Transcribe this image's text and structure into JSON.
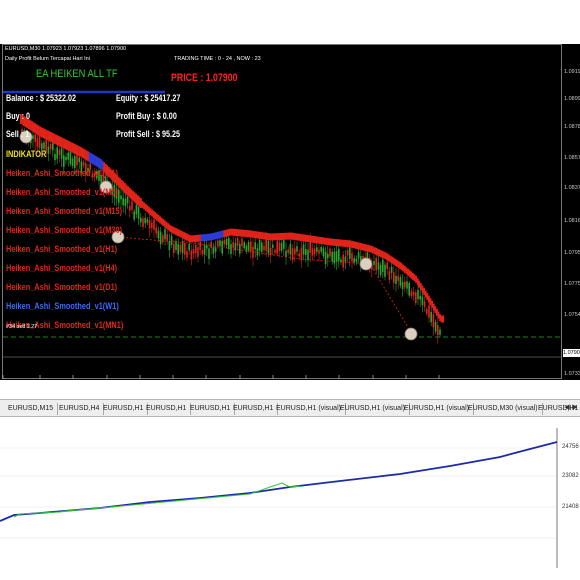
{
  "chart": {
    "symbol_header": "EURUSD,M30  1.07923 1.07923 1.07896 1.07900",
    "subheader": "Daily Profit Belum Tercapai Hari Ini",
    "trading_time": "TRADING TIME : 0 - 24 , NOW : 23",
    "ea_title": "EA HEIKEN ALL TF",
    "price_label": "PRICE : 1.07900",
    "balance": "Balance : $ 25322.02",
    "equity": "Equity : $ 25417.27",
    "buy": "Buy    : 0",
    "profit_buy": "Profit Buy    : $ 0.00",
    "sell": "Sell    : 1",
    "profit_sell": "Profit Sell    : $ 95.25",
    "indicator_header": "INDIKATOR",
    "indicators": [
      {
        "label": "Heiken_Ashi_Smoothed_v1(M1)",
        "color": "#e2231a"
      },
      {
        "label": "Heiken_Ashi_Smoothed_v1(M5)",
        "color": "#e2231a"
      },
      {
        "label": "Heiken_Ashi_Smoothed_v1(M15)",
        "color": "#e2231a"
      },
      {
        "label": "Heiken_Ashi_Smoothed_v1(M30)",
        "color": "#e2231a"
      },
      {
        "label": "Heiken_Ashi_Smoothed_v1(H1)",
        "color": "#e2231a"
      },
      {
        "label": "Heiken_Ashi_Smoothed_v1(H4)",
        "color": "#e2231a"
      },
      {
        "label": "Heiken_Ashi_Smoothed_v1(D1)",
        "color": "#e2231a"
      },
      {
        "label": "Heiken_Ashi_Smoothed_v1(W1)",
        "color": "#3b6cf0"
      },
      {
        "label": "Heiken_Ashi_Smoothed_v1(MN1)",
        "color": "#e2231a"
      }
    ],
    "order_label": "#34 sell 1.27",
    "y_ticks": [
      "1.09195",
      "1.08990",
      "1.08785",
      "1.08575",
      "1.08370",
      "1.08160",
      "1.07955",
      "1.07750",
      "1.07540",
      "1.07335"
    ],
    "price_box": "1.07900",
    "x_ticks": [
      "12 Feb 2020",
      "12 Feb 22:00",
      "13 Feb 06:00",
      "13 Feb 14:00",
      "13 Feb 22:00",
      "14 Feb 06:00",
      "14 Feb 14:00",
      "14 Feb 22:00",
      "17 Feb 06:00",
      "17 Feb 14:00",
      "17 Feb 22:00",
      "18 Feb 06:00",
      "18 Feb 14:00",
      "18 Feb 22:00"
    ],
    "colors": {
      "background": "#000000",
      "bull": "#2fa52f",
      "bear": "#e2231a",
      "blue": "#2b3cd9",
      "ea_title": "#34c934",
      "price": "#ff2020",
      "indicator_header": "#f0e020"
    }
  },
  "tabs": [
    "EURUSD,M15",
    "EURUSD,H4",
    "EURUSD,H1",
    "EURUSD,H1",
    "EURUSD,H1",
    "EURUSD,H1",
    "EURUSD,H1 (visual)",
    "EURUSD,H1 (visual)",
    "EURUSD,H1 (visual)",
    "EURUSD,M30 (visual)",
    "EURUSD,H1"
  ],
  "tab_scroll_icons": [
    "arrow-left-icon",
    "arrow-right-icon"
  ],
  "equity": {
    "y_ticks": [
      "24756",
      "23082",
      "21408"
    ],
    "colors": {
      "balance": "#1c2ba8",
      "equity": "#3cc23c"
    }
  }
}
